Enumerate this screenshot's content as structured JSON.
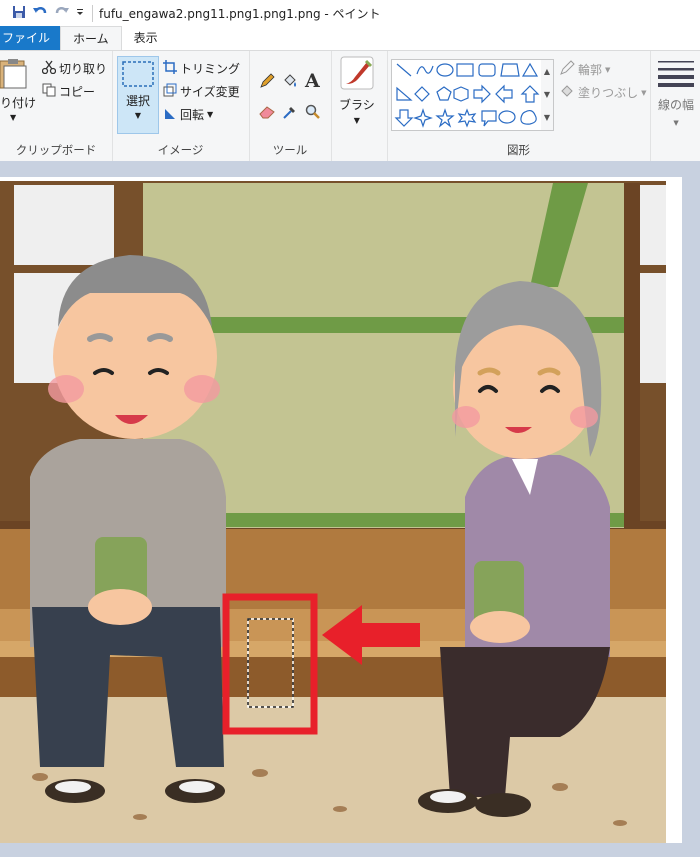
{
  "window": {
    "title": "fufu_engawa2.png11.png1.png1.png - ペイント"
  },
  "tabs": [
    {
      "label": "ファイル"
    },
    {
      "label": "ホーム"
    },
    {
      "label": "表示"
    }
  ],
  "ribbon": {
    "clipboard": {
      "paste": "り付け",
      "cut": "切り取り",
      "copy": "コピー",
      "group": "クリップボード"
    },
    "image": {
      "select": "選択",
      "crop": "トリミング",
      "resize": "サイズ変更",
      "rotate": "回転",
      "group": "イメージ"
    },
    "tools": {
      "group": "ツール",
      "text_glyph": "A"
    },
    "brush": {
      "label": "ブラシ"
    },
    "shapes": {
      "outline": "輪郭",
      "fill": "塗りつぶし",
      "group": "図形"
    },
    "size": {
      "label": "線の幅"
    }
  },
  "colors": {
    "accent": "#1979ca",
    "selection_highlight": "#cde6f7",
    "arrow_red": "#e8202a"
  }
}
